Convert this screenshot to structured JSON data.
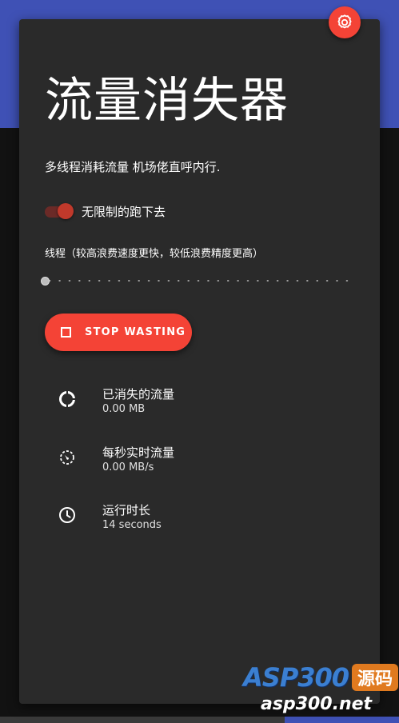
{
  "app": {
    "title": "流量消失器",
    "subtitle": "多线程消耗流量 机场佬直呼内行."
  },
  "settings_button": {
    "icon": "gear-icon"
  },
  "unlimited_switch": {
    "label": "无限制的跑下去",
    "checked": true
  },
  "threads_slider": {
    "label": "线程（较高浪费速度更快，较低浪费精度更高）",
    "value_fraction": 0.0,
    "step_count": 32
  },
  "stop_button": {
    "label": "STOP WASTING",
    "icon": "stop-icon"
  },
  "stats": [
    {
      "icon": "donut-progress-icon",
      "name": "已消失的流量",
      "value": "0.00 MB"
    },
    {
      "icon": "speedometer-icon",
      "name": "每秒实时流量",
      "value": "0.00 MB/s"
    },
    {
      "icon": "clock-icon",
      "name": "运行时长",
      "value": "14 seconds"
    }
  ],
  "watermark": {
    "brand": "ASP300",
    "badge": "源码",
    "domain": "asp300.net"
  },
  "colors": {
    "primary": "#3f51b5",
    "accent": "#f44336",
    "card": "#2a2a2a",
    "background": "#121212"
  }
}
